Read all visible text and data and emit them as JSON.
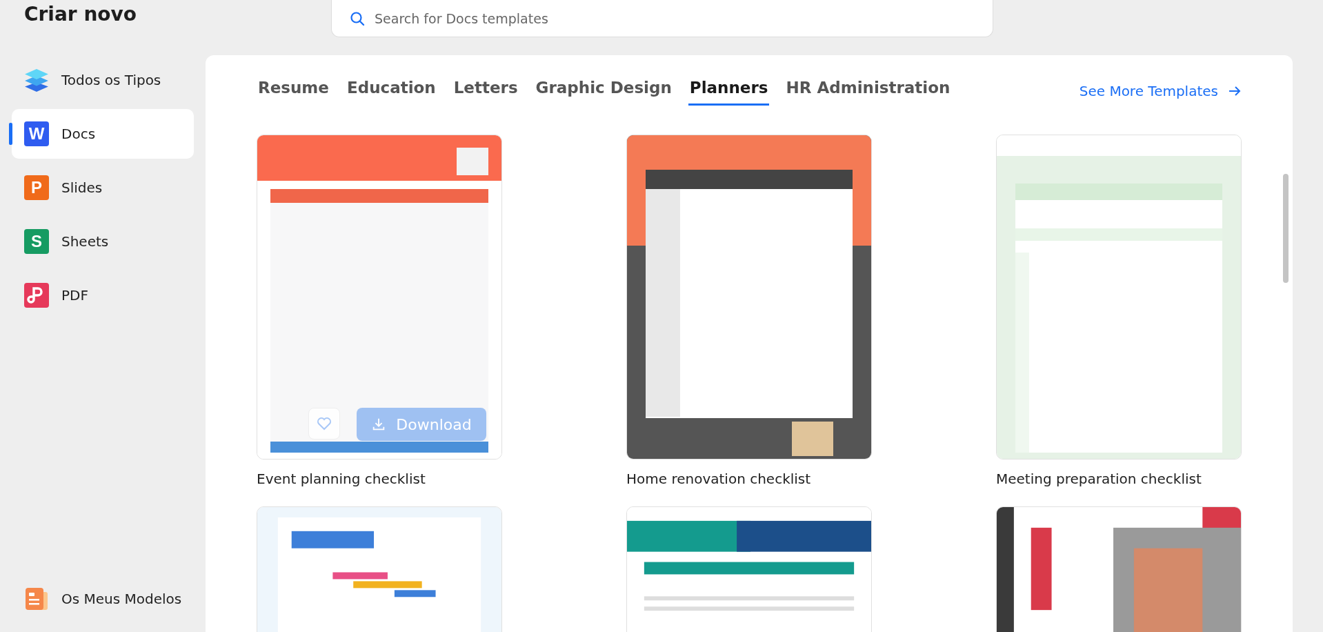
{
  "header": {
    "title": "Criar novo"
  },
  "search": {
    "placeholder": "Search for Docs templates"
  },
  "sidebar": {
    "items": [
      {
        "label": "Todos os Tipos",
        "kind": "layers",
        "selected": false
      },
      {
        "label": "Docs",
        "kind": "letter",
        "letter": "W",
        "color": "#2f5cf0",
        "selected": true
      },
      {
        "label": "Slides",
        "kind": "letter",
        "letter": "P",
        "color": "#f06a1a",
        "selected": false
      },
      {
        "label": "Sheets",
        "kind": "letter",
        "letter": "S",
        "color": "#169b62",
        "selected": false
      },
      {
        "label": "PDF",
        "kind": "pdf",
        "color": "#e6395a",
        "selected": false
      }
    ],
    "bottom_item": {
      "label": "Os Meus Modelos",
      "kind": "templates",
      "selected": false
    }
  },
  "tabs": [
    {
      "label": "Resume",
      "selected": false
    },
    {
      "label": "Education",
      "selected": false
    },
    {
      "label": "Letters",
      "selected": false
    },
    {
      "label": "Graphic Design",
      "selected": false
    },
    {
      "label": "Planners",
      "selected": true
    },
    {
      "label": "HR Administration",
      "selected": false
    }
  ],
  "see_more": {
    "label": "See More Templates"
  },
  "cards": [
    {
      "title": "Event planning checklist",
      "kind": "picture",
      "hovered": true,
      "download_label": "Download"
    },
    {
      "title": "Home renovation checklist",
      "kind": "picture",
      "hovered": false
    },
    {
      "title": "Meeting preparation checklist",
      "kind": "picture",
      "hovered": false
    },
    {
      "kind": "picture",
      "hovered": false
    },
    {
      "kind": "picture",
      "hovered": false
    },
    {
      "kind": "picture",
      "hovered": false
    }
  ]
}
